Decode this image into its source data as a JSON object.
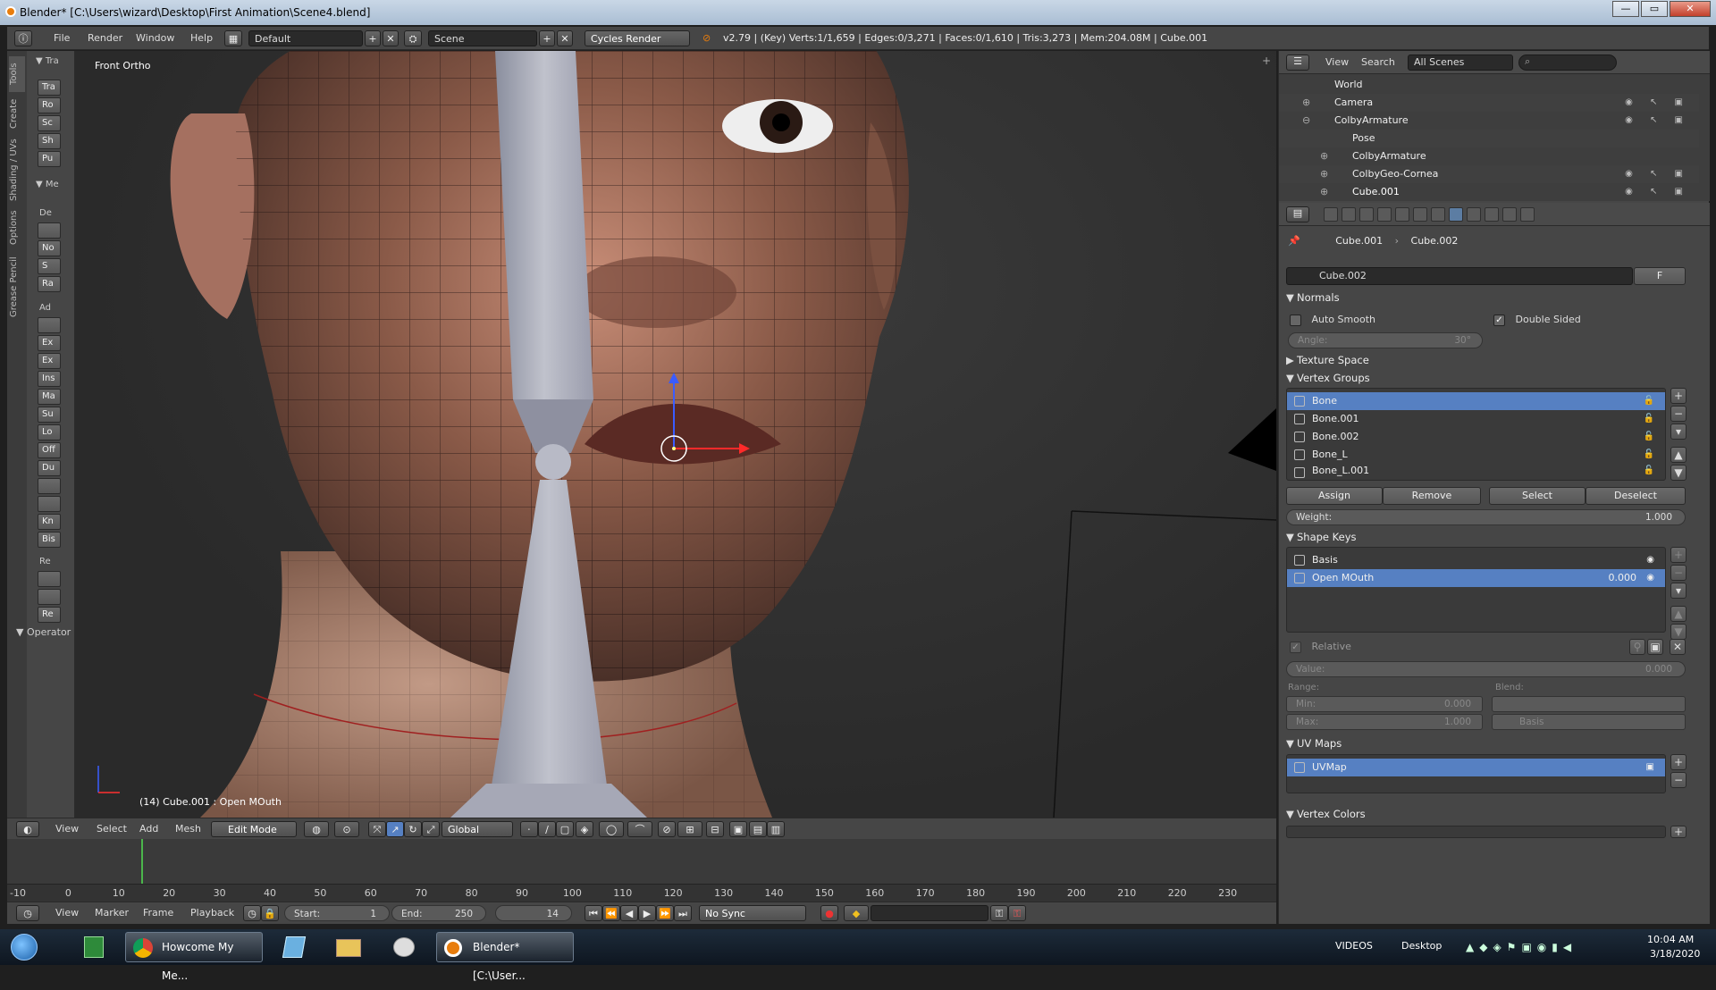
{
  "window": {
    "title": "Blender* [C:\\Users\\wizard\\Desktop\\First Animation\\Scene4.blend]",
    "min": "—",
    "max": "▭",
    "close": "✕"
  },
  "topbar": {
    "menus": [
      "File",
      "Render",
      "Window",
      "Help"
    ],
    "layout": "Default",
    "scene": "Scene",
    "engine": "Cycles Render",
    "stats": "v2.79 | (Key) Verts:1/1,659 | Edges:0/3,271 | Faces:0/1,610 | Tris:3,273 | Mem:204.08M | Cube.001"
  },
  "viewport": {
    "label": "Front Ortho",
    "object_info": "(14) Cube.001 : Open MOuth"
  },
  "toolshelf": {
    "tabs": [
      "Tools",
      "Create",
      "Shading / UVs",
      "Options",
      "Grease Pencil"
    ],
    "sections": [
      "Tra",
      "Me",
      "Operator"
    ],
    "transform_buttons": [
      "Tra",
      "Ro",
      "Sc",
      "Sh",
      "Pu"
    ],
    "mesh_labels": [
      "De",
      "Ad",
      "Re"
    ],
    "mesh_buttons": [
      "",
      "No",
      "S",
      "Ra",
      "",
      "Ex",
      "Ex",
      "Ins",
      "Ma",
      "Su",
      "Lo",
      "Off",
      "Du",
      "",
      "",
      "Kn",
      "Bis"
    ],
    "remove_buttons": [
      "",
      "",
      "Re"
    ]
  },
  "vpheader": {
    "menus": [
      "View",
      "Select",
      "Add",
      "Mesh"
    ],
    "mode": "Edit Mode",
    "orientation": "Global"
  },
  "timeline": {
    "ticks": [
      "-10",
      "0",
      "10",
      "20",
      "30",
      "40",
      "50",
      "60",
      "70",
      "80",
      "90",
      "100",
      "110",
      "120",
      "130",
      "140",
      "150",
      "160",
      "170",
      "180",
      "190",
      "200",
      "210",
      "220",
      "230"
    ],
    "current_frame": 14,
    "menus": [
      "View",
      "Marker",
      "Frame",
      "Playback"
    ],
    "start_label": "Start:",
    "start": "1",
    "end_label": "End:",
    "end": "250",
    "frame": "14",
    "sync": "No Sync"
  },
  "outliner": {
    "menus": [
      "View",
      "Search"
    ],
    "filter": "All Scenes",
    "search_placeholder": "",
    "rows": [
      {
        "name": "World",
        "color": "#8ab4d8"
      },
      {
        "name": "Camera",
        "color": "#c9793a"
      },
      {
        "name": "ColbyArmature",
        "color": "#d8a05a"
      },
      {
        "name": "Pose",
        "color": "#bbbbbb"
      },
      {
        "name": "ColbyArmature",
        "color": "#d8d8d8"
      },
      {
        "name": "ColbyGeo-Cornea",
        "color": "#e8a040"
      },
      {
        "name": "Cube.001",
        "color": "#e8a040"
      }
    ]
  },
  "properties": {
    "breadcrumb": [
      "Cube.001",
      "Cube.002"
    ],
    "mesh_name": "Cube.002",
    "fake_user": "F",
    "normals": {
      "title": "Normals",
      "auto_smooth": "Auto Smooth",
      "double_sided": "Double Sided",
      "angle_label": "Angle:",
      "angle": "30°"
    },
    "texture_space": "Texture Space",
    "vertex_groups": {
      "title": "Vertex Groups",
      "items": [
        "Bone",
        "Bone.001",
        "Bone.002",
        "Bone_L",
        "Bone_L.001"
      ],
      "buttons": [
        "Assign",
        "Remove",
        "Select",
        "Deselect"
      ],
      "weight_label": "Weight:",
      "weight": "1.000"
    },
    "shape_keys": {
      "title": "Shape Keys",
      "items": [
        {
          "name": "Basis",
          "value": ""
        },
        {
          "name": "Open MOuth",
          "value": "0.000"
        }
      ],
      "relative": "Relative",
      "value_label": "Value:",
      "value": "0.000",
      "range_label": "Range:",
      "blend_label": "Blend:",
      "min_label": "Min:",
      "min": "0.000",
      "max_label": "Max:",
      "max": "1.000",
      "blend_basis": "Basis"
    },
    "uv_maps": {
      "title": "UV Maps",
      "items": [
        "UVMap"
      ]
    },
    "vertex_colors": {
      "title": "Vertex Colors"
    }
  },
  "taskbar": {
    "apps": [
      "Howcome My Me...",
      "Blender* [C:\\User..."
    ],
    "tray_labels": [
      "VIDEOS",
      "Desktop"
    ],
    "time": "10:04 AM",
    "date": "3/18/2020"
  },
  "colors": {
    "selection": "#5680c2",
    "header": "#464646",
    "accent": "#e87d0d"
  }
}
